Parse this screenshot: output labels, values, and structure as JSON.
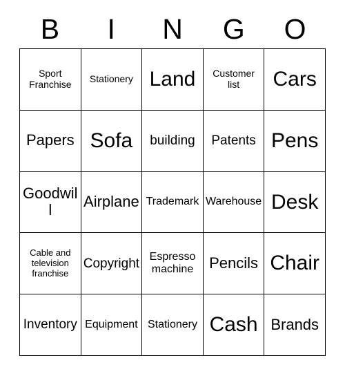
{
  "card": {
    "title": "BINGO",
    "header_letters": [
      "B",
      "I",
      "N",
      "G",
      "O"
    ],
    "rows": 5,
    "columns": 5,
    "grid_line_color": "#000000",
    "background_color": "#ffffff",
    "text_color": "#000000",
    "cells": [
      [
        {
          "text": "Sport Franchise",
          "size": "xs",
          "marked": false
        },
        {
          "text": "Stationery",
          "size": "xs",
          "marked": false
        },
        {
          "text": "Land",
          "size": "xxl",
          "marked": false
        },
        {
          "text": "Customer list",
          "size": "xs",
          "marked": false
        },
        {
          "text": "Cars",
          "size": "xxl",
          "marked": false
        }
      ],
      [
        {
          "text": "Papers",
          "size": "lg",
          "marked": false
        },
        {
          "text": "Sofa",
          "size": "xxl",
          "marked": false
        },
        {
          "text": "building",
          "size": "md",
          "marked": false
        },
        {
          "text": "Patents",
          "size": "md",
          "marked": false
        },
        {
          "text": "Pens",
          "size": "xxl",
          "marked": false
        }
      ],
      [
        {
          "text": "Goodwill",
          "size": "lg",
          "marked": false
        },
        {
          "text": "Airplane",
          "size": "lg",
          "marked": false
        },
        {
          "text": "Trademark",
          "size": "sm",
          "marked": false
        },
        {
          "text": "Warehouse",
          "size": "sm",
          "marked": false
        },
        {
          "text": "Desk",
          "size": "xxl",
          "marked": false
        }
      ],
      [
        {
          "text": "Cable and television franchise",
          "size": "xxs",
          "marked": false
        },
        {
          "text": "Copyright",
          "size": "md",
          "marked": false
        },
        {
          "text": "Espresso machine",
          "size": "sm",
          "marked": false
        },
        {
          "text": "Pencils",
          "size": "lg",
          "marked": false
        },
        {
          "text": "Chair",
          "size": "xxl",
          "marked": false
        }
      ],
      [
        {
          "text": "Inventory",
          "size": "md",
          "marked": false
        },
        {
          "text": "Equipment",
          "size": "sm",
          "marked": false
        },
        {
          "text": "Stationery",
          "size": "sm",
          "marked": false
        },
        {
          "text": "Cash",
          "size": "xxl",
          "marked": false
        },
        {
          "text": "Brands",
          "size": "lg",
          "marked": false
        }
      ]
    ]
  }
}
